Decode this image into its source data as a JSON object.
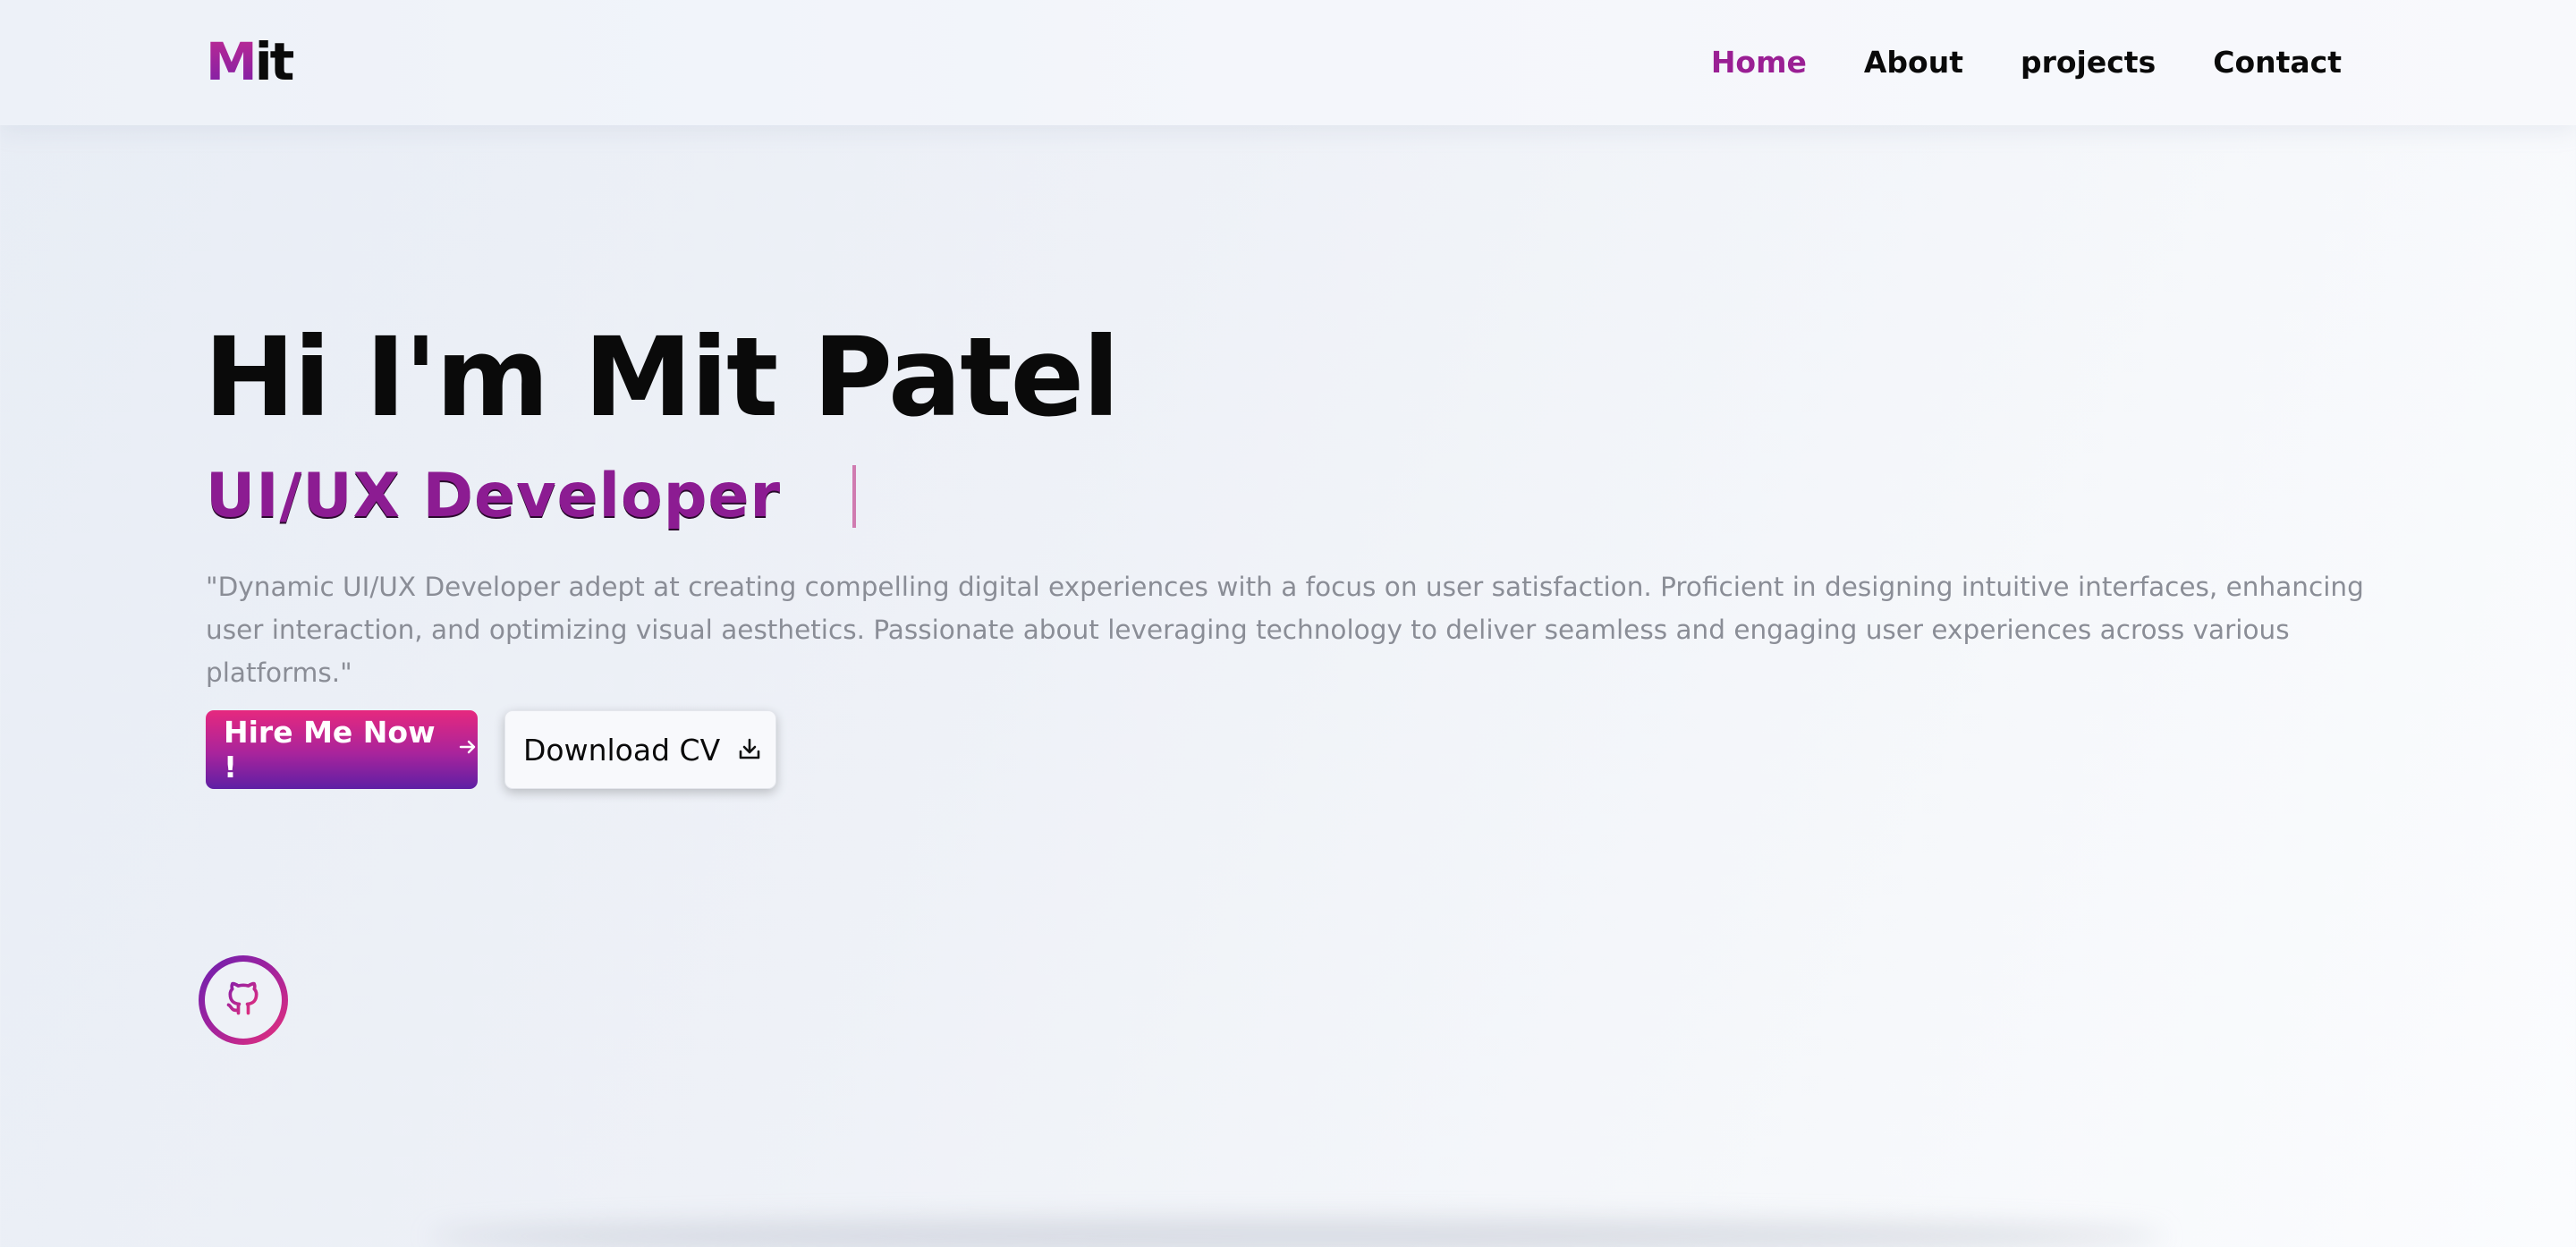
{
  "header": {
    "logo": {
      "first_letter": "M",
      "rest": "it"
    },
    "nav": [
      {
        "label": "Home",
        "active": true
      },
      {
        "label": "About",
        "active": false
      },
      {
        "label": "projects",
        "active": false
      },
      {
        "label": "Contact",
        "active": false
      }
    ]
  },
  "hero": {
    "title": "Hi I'm Mit Patel",
    "role": "UI/UX Developer",
    "description": "\"Dynamic UI/UX Developer adept at creating compelling digital experiences with a focus on user satisfaction. Proficient in designing intuitive interfaces, enhancing user interaction, and optimizing visual aesthetics. Passionate about leveraging technology to deliver seamless and engaging user experiences across various platforms.\"",
    "buttons": {
      "hire_label": "Hire Me Now !",
      "hire_icon": "arrow-right-icon",
      "cv_label": "Download CV",
      "cv_icon": "download-icon"
    },
    "social": {
      "icon": "github-icon"
    }
  },
  "colors": {
    "accent": "#9a1f94",
    "gradient_start": "#e6287e",
    "gradient_end": "#5e1fa4",
    "text_dark": "#0a0a0a",
    "text_muted": "#8a8d96"
  }
}
